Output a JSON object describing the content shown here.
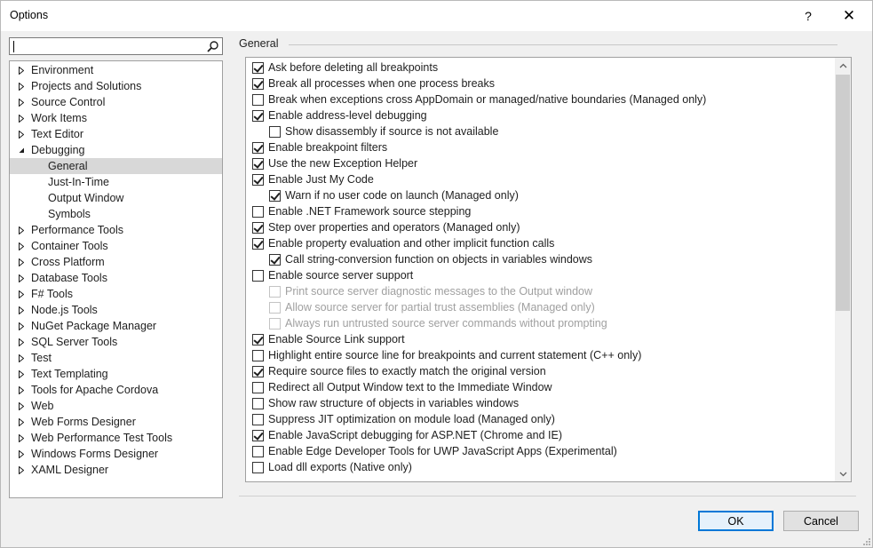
{
  "window": {
    "title": "Options",
    "help_glyph": "?",
    "close_glyph": "✕"
  },
  "search": {
    "value": "",
    "placeholder": ""
  },
  "tree": [
    {
      "label": "Environment",
      "level": 0,
      "expander": "collapsed"
    },
    {
      "label": "Projects and Solutions",
      "level": 0,
      "expander": "collapsed"
    },
    {
      "label": "Source Control",
      "level": 0,
      "expander": "collapsed"
    },
    {
      "label": "Work Items",
      "level": 0,
      "expander": "collapsed"
    },
    {
      "label": "Text Editor",
      "level": 0,
      "expander": "collapsed"
    },
    {
      "label": "Debugging",
      "level": 0,
      "expander": "expanded"
    },
    {
      "label": "General",
      "level": 1,
      "selected": true
    },
    {
      "label": "Just-In-Time",
      "level": 1
    },
    {
      "label": "Output Window",
      "level": 1
    },
    {
      "label": "Symbols",
      "level": 1
    },
    {
      "label": "Performance Tools",
      "level": 0,
      "expander": "collapsed"
    },
    {
      "label": "Container Tools",
      "level": 0,
      "expander": "collapsed"
    },
    {
      "label": "Cross Platform",
      "level": 0,
      "expander": "collapsed"
    },
    {
      "label": "Database Tools",
      "level": 0,
      "expander": "collapsed"
    },
    {
      "label": "F# Tools",
      "level": 0,
      "expander": "collapsed"
    },
    {
      "label": "Node.js Tools",
      "level": 0,
      "expander": "collapsed"
    },
    {
      "label": "NuGet Package Manager",
      "level": 0,
      "expander": "collapsed"
    },
    {
      "label": "SQL Server Tools",
      "level": 0,
      "expander": "collapsed"
    },
    {
      "label": "Test",
      "level": 0,
      "expander": "collapsed"
    },
    {
      "label": "Text Templating",
      "level": 0,
      "expander": "collapsed"
    },
    {
      "label": "Tools for Apache Cordova",
      "level": 0,
      "expander": "collapsed"
    },
    {
      "label": "Web",
      "level": 0,
      "expander": "collapsed"
    },
    {
      "label": "Web Forms Designer",
      "level": 0,
      "expander": "collapsed"
    },
    {
      "label": "Web Performance Test Tools",
      "level": 0,
      "expander": "collapsed"
    },
    {
      "label": "Windows Forms Designer",
      "level": 0,
      "expander": "collapsed"
    },
    {
      "label": "XAML Designer",
      "level": 0,
      "expander": "collapsed"
    }
  ],
  "section": {
    "title": "General"
  },
  "options": [
    {
      "label": "Ask before deleting all breakpoints",
      "checked": true,
      "indent": 0,
      "enabled": true
    },
    {
      "label": "Break all processes when one process breaks",
      "checked": true,
      "indent": 0,
      "enabled": true
    },
    {
      "label": "Break when exceptions cross AppDomain or managed/native boundaries (Managed only)",
      "checked": false,
      "indent": 0,
      "enabled": true
    },
    {
      "label": "Enable address-level debugging",
      "checked": true,
      "indent": 0,
      "enabled": true
    },
    {
      "label": "Show disassembly if source is not available",
      "checked": false,
      "indent": 1,
      "enabled": true
    },
    {
      "label": "Enable breakpoint filters",
      "checked": true,
      "indent": 0,
      "enabled": true
    },
    {
      "label": "Use the new Exception Helper",
      "checked": true,
      "indent": 0,
      "enabled": true
    },
    {
      "label": "Enable Just My Code",
      "checked": true,
      "indent": 0,
      "enabled": true
    },
    {
      "label": "Warn if no user code on launch (Managed only)",
      "checked": true,
      "indent": 1,
      "enabled": true
    },
    {
      "label": "Enable .NET Framework source stepping",
      "checked": false,
      "indent": 0,
      "enabled": true
    },
    {
      "label": "Step over properties and operators (Managed only)",
      "checked": true,
      "indent": 0,
      "enabled": true
    },
    {
      "label": "Enable property evaluation and other implicit function calls",
      "checked": true,
      "indent": 0,
      "enabled": true
    },
    {
      "label": "Call string-conversion function on objects in variables windows",
      "checked": true,
      "indent": 1,
      "enabled": true
    },
    {
      "label": "Enable source server support",
      "checked": false,
      "indent": 0,
      "enabled": true
    },
    {
      "label": "Print source server diagnostic messages to the Output window",
      "checked": false,
      "indent": 1,
      "enabled": false
    },
    {
      "label": "Allow source server for partial trust assemblies (Managed only)",
      "checked": false,
      "indent": 1,
      "enabled": false
    },
    {
      "label": "Always run untrusted source server commands without prompting",
      "checked": false,
      "indent": 1,
      "enabled": false
    },
    {
      "label": "Enable Source Link support",
      "checked": true,
      "indent": 0,
      "enabled": true
    },
    {
      "label": "Highlight entire source line for breakpoints and current statement (C++ only)",
      "checked": false,
      "indent": 0,
      "enabled": true
    },
    {
      "label": "Require source files to exactly match the original version",
      "checked": true,
      "indent": 0,
      "enabled": true
    },
    {
      "label": "Redirect all Output Window text to the Immediate Window",
      "checked": false,
      "indent": 0,
      "enabled": true
    },
    {
      "label": "Show raw structure of objects in variables windows",
      "checked": false,
      "indent": 0,
      "enabled": true
    },
    {
      "label": "Suppress JIT optimization on module load (Managed only)",
      "checked": false,
      "indent": 0,
      "enabled": true
    },
    {
      "label": "Enable JavaScript debugging for ASP.NET (Chrome and IE)",
      "checked": true,
      "indent": 0,
      "enabled": true
    },
    {
      "label": "Enable Edge Developer Tools for UWP JavaScript Apps (Experimental)",
      "checked": false,
      "indent": 0,
      "enabled": true
    },
    {
      "label": "Load dll exports (Native only)",
      "checked": false,
      "indent": 0,
      "enabled": true
    }
  ],
  "buttons": {
    "ok": "OK",
    "cancel": "Cancel"
  },
  "colors": {
    "accent": "#0078d7",
    "selection": "#d8d8d8",
    "disabled_text": "#a0a0a0"
  }
}
